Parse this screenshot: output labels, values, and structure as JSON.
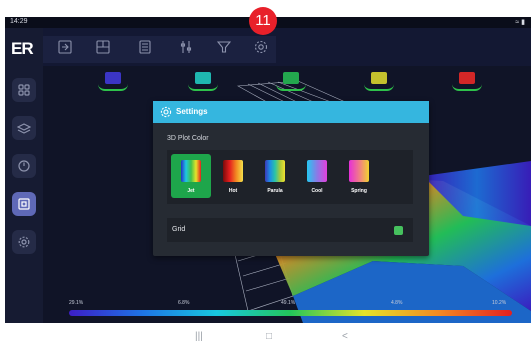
{
  "status": {
    "time": "14:29",
    "signal": "≈ ▮"
  },
  "callout_number": "11",
  "logo_text": "ER",
  "colors": {
    "accent": "#35b6df",
    "active_swatch": "#1ea64b",
    "toggle_on": "#46c15e",
    "sidebar_active": "#5f69b7"
  },
  "sidebar": {
    "items": [
      {
        "icon": "grid-icon"
      },
      {
        "icon": "layers-icon"
      },
      {
        "icon": "speed-icon"
      },
      {
        "icon": "plot-3d-icon",
        "active": true
      },
      {
        "icon": "settings-icon"
      }
    ]
  },
  "toolbar": {
    "items": [
      "import-icon",
      "layout-icon",
      "calculator-icon",
      "sliders-icon",
      "filter-icon",
      "settings-icon"
    ]
  },
  "series_chips": [
    "#3b35c6",
    "#1fb7b0",
    "#23a84e",
    "#c4c12d",
    "#d32727"
  ],
  "colorbar": {
    "ticks": [
      "29.1%",
      "6.8%",
      "49.1%",
      "4.8%",
      "10.2%"
    ]
  },
  "dialog": {
    "title": "Settings",
    "section_label": "3D Plot Color",
    "swatches": [
      {
        "label": "Jet",
        "selected": true
      },
      {
        "label": "Hot",
        "selected": false
      },
      {
        "label": "Parula",
        "selected": false
      },
      {
        "label": "Cool",
        "selected": false
      },
      {
        "label": "Spring",
        "selected": false
      }
    ],
    "grid_label": "Grid",
    "grid_enabled": true
  },
  "nav": {
    "recents": "|||",
    "home": "□",
    "back": "<"
  }
}
